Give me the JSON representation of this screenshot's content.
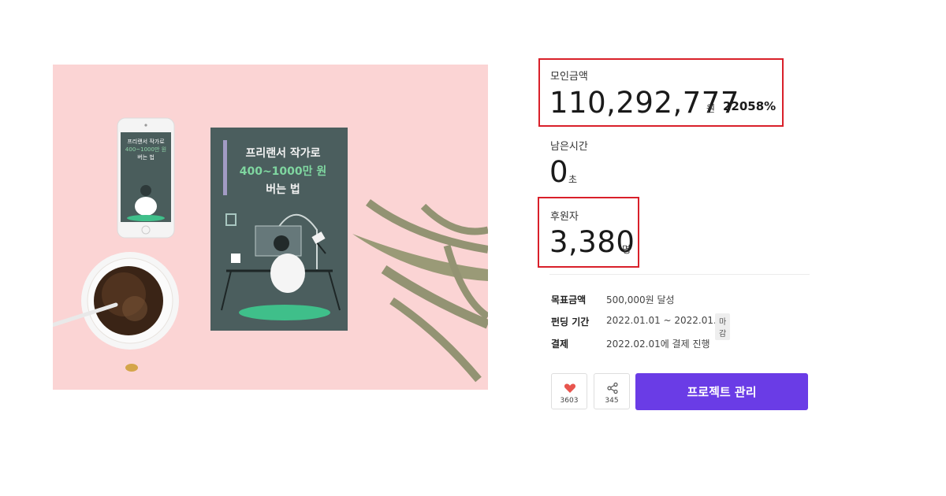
{
  "hero": {
    "book_title_line1": "프리랜서 작가로",
    "book_title_line2": "400~1000만 원",
    "book_title_line3": "버는 법",
    "phone_line1": "프리랜서 작가로",
    "phone_line2": "400~1000만 원",
    "phone_line3": "버는 법"
  },
  "funding": {
    "amount_label": "모인금액",
    "amount_value": "110,292,777",
    "amount_unit": "원",
    "amount_percent": "22058%",
    "time_label": "남은시간",
    "time_value": "0",
    "time_unit": "초",
    "backers_label": "후원자",
    "backers_value": "3,380",
    "backers_unit": "명"
  },
  "info": {
    "goal_label": "목표금액",
    "goal_value": "500,000원 달성",
    "period_label": "펀딩 기간",
    "period_value": "2022.01.01 ~ 2022.01.31",
    "period_badge": "마감",
    "payment_label": "결제",
    "payment_value": "2022.02.01에 결제 진행"
  },
  "actions": {
    "like_count": "3603",
    "share_count": "345",
    "manage_label": "프로젝트 관리"
  },
  "colors": {
    "accent": "#6a3ce6",
    "highlight_border": "#d9202a",
    "hero_bg": "#fbd4d4",
    "heart": "#e8554e"
  }
}
